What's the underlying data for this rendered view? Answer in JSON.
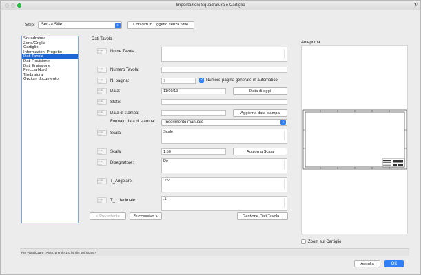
{
  "window": {
    "title": "Impostazioni Squadratura e Cartiglio"
  },
  "style_row": {
    "label": "Stile:",
    "selected": "Senza Stile",
    "convert_button": "Converti in Oggetto senza Stile"
  },
  "sidebar": {
    "items": [
      {
        "label": "Squadratura",
        "selected": false
      },
      {
        "label": "Zone/Griglia",
        "selected": false
      },
      {
        "label": "Cartiglio",
        "selected": false
      },
      {
        "label": "Informazioni Progetto",
        "selected": false
      },
      {
        "label": "Dati Tavola",
        "selected": true
      },
      {
        "label": "Dati Revisione",
        "selected": false
      },
      {
        "label": "Dati Emissione",
        "selected": false
      },
      {
        "label": "Freccia Nord",
        "selected": false
      },
      {
        "label": "Timbratura",
        "selected": false
      },
      {
        "label": "Opzioni documento",
        "selected": false
      }
    ]
  },
  "section": {
    "title": "Dati Tavola"
  },
  "fields": {
    "tag_text": "single sign",
    "nome_tavola": {
      "label": "Nome Tavola:",
      "value": ""
    },
    "numero_tavola": {
      "label": "Numero Tavola:",
      "value": ""
    },
    "n_pagina": {
      "label": "N. pagina:",
      "value": "1",
      "checkbox_label": "Numero pagina generato in automatico",
      "checked": true
    },
    "data": {
      "label": "Data:",
      "value": "11/09/19",
      "button": "Data di oggi"
    },
    "stato": {
      "label": "Stato:",
      "value": ""
    },
    "data_stampa": {
      "label": "Data di stampa:",
      "value": "",
      "button": "Aggiorna data stampa"
    },
    "formato_data": {
      "label": "Formato data di stampa:",
      "selected": "Inserimento manuale"
    },
    "scala_text": {
      "label": "Scala:",
      "value": "Scale"
    },
    "scala": {
      "label": "Scala:",
      "value": "1:50",
      "button": "Aggiorna Scala"
    },
    "disegnatore": {
      "label": "Disegnatore:",
      "value": "Rv"
    },
    "t_angolare": {
      "label": "T_Angolare:",
      "value": ".25°"
    },
    "t_decimale": {
      "label": "T_1 decimale:",
      "value": ".1"
    }
  },
  "nav": {
    "prev": "< Precedente",
    "next": "Successivo >",
    "manage": "Gestione Dati Tavola..."
  },
  "preview": {
    "title": "Anteprima",
    "zoom_label": "Zoom sul Cartiglio",
    "zoom_checked": false
  },
  "status": "Per visualizzare l'Aiuto, premi F1 o fai clic sull'icona ?",
  "footer": {
    "cancel": "Annulla",
    "ok": "OK"
  },
  "colors": {
    "accent": "#2f7ff6",
    "selection": "#1c66d6"
  }
}
